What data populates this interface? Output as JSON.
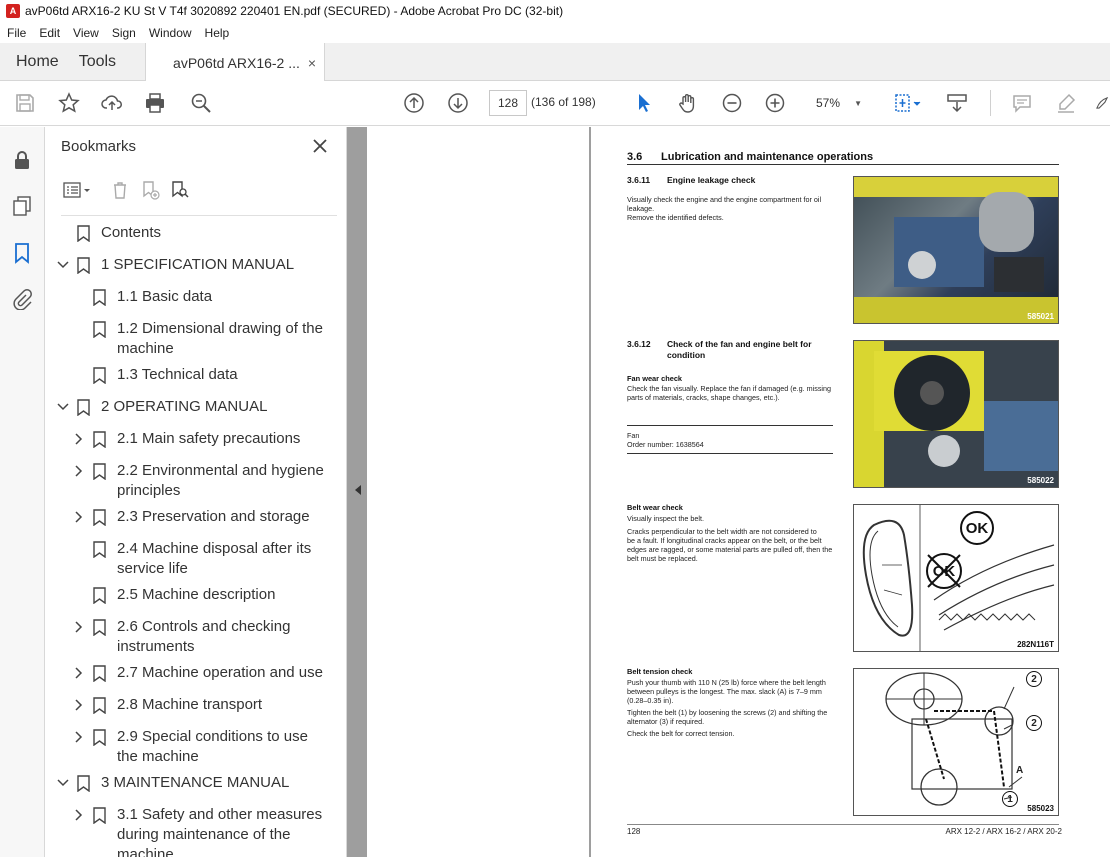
{
  "window": {
    "title": "avP06td ARX16-2 KU St V T4f 3020892 220401 EN.pdf (SECURED) - Adobe Acrobat Pro DC (32-bit)",
    "app_icon_letter": "A"
  },
  "menu": [
    "File",
    "Edit",
    "View",
    "Sign",
    "Window",
    "Help"
  ],
  "tabs": {
    "home": "Home",
    "tools": "Tools",
    "document": "avP06td ARX16-2 ...",
    "close": "×"
  },
  "toolbar": {
    "page_number": "128",
    "page_count": "(136 of 198)",
    "zoom": "57%"
  },
  "bookmarks": {
    "title": "Bookmarks",
    "items": [
      {
        "label": "Contents",
        "line2": ""
      },
      {
        "label": "1 SPECIFICATION MANUAL",
        "line2": ""
      },
      {
        "label": "1.1 Basic data",
        "line2": ""
      },
      {
        "label": "1.2 Dimensional drawing of the",
        "line2": "machine"
      },
      {
        "label": "1.3 Technical data",
        "line2": ""
      },
      {
        "label": "2 OPERATING MANUAL",
        "line2": ""
      },
      {
        "label": "2.1 Main safety precautions",
        "line2": ""
      },
      {
        "label": "2.2 Environmental and hygiene",
        "line2": "principles"
      },
      {
        "label": "2.3 Preservation and storage",
        "line2": ""
      },
      {
        "label": "2.4 Machine disposal after its",
        "line2": "service life"
      },
      {
        "label": "2.5 Machine description",
        "line2": ""
      },
      {
        "label": "2.6 Controls and checking",
        "line2": "instruments"
      },
      {
        "label": "2.7 Machine operation and use",
        "line2": ""
      },
      {
        "label": "2.8 Machine transport",
        "line2": ""
      },
      {
        "label": "2.9 Special conditions to use",
        "line2": "the machine"
      },
      {
        "label": "3 MAINTENANCE MANUAL",
        "line2": ""
      },
      {
        "label": "3.1 Safety and other measures",
        "line2": "during maintenance of the",
        "line3": "machine"
      }
    ]
  },
  "page": {
    "section_num": "3.6",
    "section_title": "Lubrication and maintenance operations",
    "s1_num": "3.6.11",
    "s1_title": "Engine leakage check",
    "s1_text1": "Visually check the engine and the engine compartment for oil",
    "s1_text2": "leakage.",
    "s1_text3": "Remove the identified defects.",
    "photo1_tag": "585021",
    "s2_num": "3.6.12",
    "s2_title1": "Check of the fan and engine belt for",
    "s2_title2": "condition",
    "fan_head": "Fan wear check",
    "fan_text1": "Check the fan visually. Replace the fan if damaged (e.g. missing",
    "fan_text2": "parts of materials, cracks, shape changes, etc.).",
    "fan_part": "Fan",
    "fan_order": "Order number: 1638564",
    "photo2_tag": "585022",
    "belt_head": "Belt wear check",
    "belt_text0": "Visually inspect the belt.",
    "belt_text1": "Cracks perpendicular to the belt width are not considered to",
    "belt_text2": "be a fault. If longitudinal cracks appear on the belt, or the belt",
    "belt_text3": "edges are ragged, or some material parts are pulled off, then the",
    "belt_text4": "belt must be replaced.",
    "fig3_ok": "OK",
    "fig3_notok": "OK",
    "fig3_tag": "282N116T",
    "tens_head": "Belt tension check",
    "tens_text1": "Push your thumb with 110 N (25 lb) force where the belt length",
    "tens_text2": "between pulleys is the longest. The max. slack (A) is 7–9 mm",
    "tens_text3": "(0.28–0.35 in).",
    "tens_text4": "Tighten the belt (1) by loosening the screws (2) and shifting the",
    "tens_text5": "alternator (3) if required.",
    "tens_text6": "Check the belt for correct tension.",
    "fig4_c1": "2",
    "fig4_c2": "2",
    "fig4_c3": "1",
    "fig4_a": "A",
    "fig4_tag": "585023",
    "footer_left": "128",
    "footer_right": "ARX 12-2 / ARX 16-2 / ARX 20-2"
  }
}
